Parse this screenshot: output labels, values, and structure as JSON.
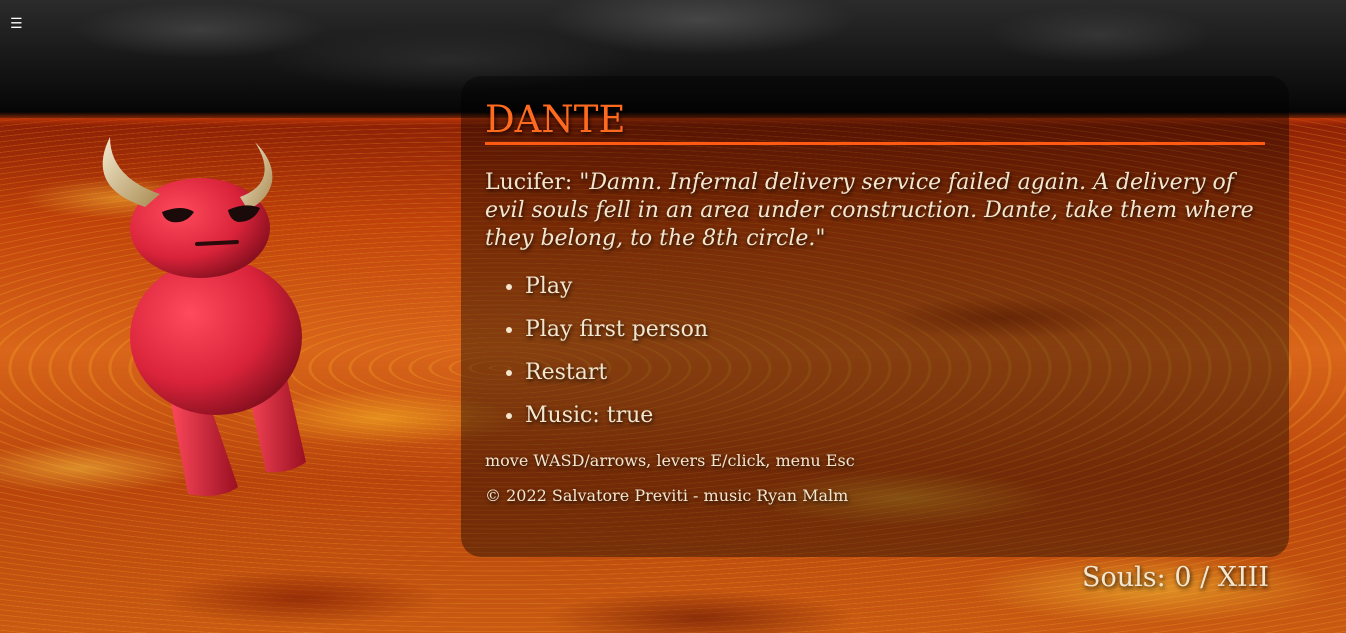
{
  "menu_button": {
    "icon": "hamburger-icon",
    "glyph": "☰"
  },
  "panel": {
    "title": "DANTE",
    "speaker": "Lucifer:",
    "quote": "\"Damn. Infernal delivery service failed again. A delivery of evil souls fell in an area under construction. Dante, take them where they belong, to the 8th circle.\"",
    "options": [
      {
        "label": "Play"
      },
      {
        "label": "Play first person"
      },
      {
        "label": "Restart"
      },
      {
        "label": "Music: true"
      }
    ],
    "hint": "move WASD/arrows, levers E/click, menu Esc",
    "copyright": "© 2022 Salvatore Previti - music Ryan Malm"
  },
  "hud": {
    "souls": "Souls: 0 / XIII"
  },
  "colors": {
    "title": "#ff6a1e",
    "text": "#f3e6cf",
    "devil": "#d8233a",
    "horns": "#e8d6a0"
  }
}
